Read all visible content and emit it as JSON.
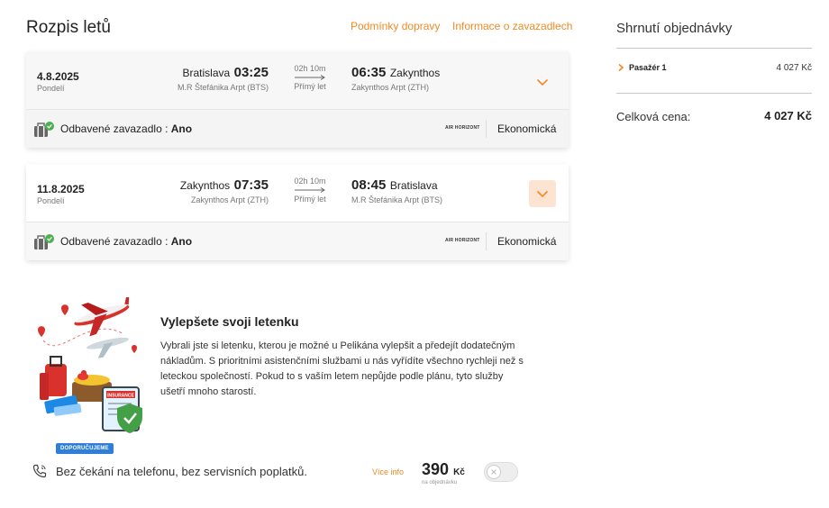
{
  "header": {
    "title": "Rozpis letů",
    "links": [
      "Podmínky dopravy",
      "Informace o zavazadlech"
    ]
  },
  "flights": [
    {
      "date": "4.8.2025",
      "weekday": "Pondelí",
      "dep_city": "Bratislava",
      "dep_time": "03:25",
      "dep_airport": "M.R Štefánika Arpt (BTS)",
      "duration": "02h 10m",
      "stops": "Přímý let",
      "arr_time": "06:35",
      "arr_city": "Zakynthos",
      "arr_airport": "Zakynthos Arpt (ZTH)",
      "baggage_label": "Odbavené zavazadlo :",
      "baggage_value": "Ano",
      "airline": "AIR HORIZONT",
      "fare_class": "Ekonomická"
    },
    {
      "date": "11.8.2025",
      "weekday": "Pondelí",
      "dep_city": "Zakynthos",
      "dep_time": "07:35",
      "dep_airport": "Zakynthos Arpt (ZTH)",
      "duration": "02h 10m",
      "stops": "Přímý let",
      "arr_time": "08:45",
      "arr_city": "Bratislava",
      "arr_airport": "M.R Štefánika Arpt (BTS)",
      "baggage_label": "Odbavené zavazadlo :",
      "baggage_value": "Ano",
      "airline": "AIR HORIZONT",
      "fare_class": "Ekonomická"
    }
  ],
  "summary": {
    "title": "Shrnutí objednávky",
    "passenger_label": "Pasažér 1",
    "passenger_price": "4 027 Kč",
    "total_label": "Celková cena:",
    "total_price": "4 027 Kč"
  },
  "upsell": {
    "badge": "DOPORUČUJEME",
    "title": "Vylepšete svoji letenku",
    "text": "Vybrali jste si letenku, kterou je možné u Pelikána vylepšit a předejít dodatečným nákladům. S prioritními asistenčními službami u nás vyřídíte všechno rychleji než s leteckou společností. Pokud to s vaším letem nepůjde podle plánu, tyto služby ušetří mnoho starostí.",
    "illustration_label": "INSURANCE",
    "service_label": "Bez čekání na telefonu, bez servisních poplatků.",
    "more_info": "Více info",
    "price": "390",
    "currency": "Kč",
    "price_note": "na objednávku",
    "toggle_on": false
  },
  "colors": {
    "accent": "#f08a24",
    "badge": "#2f7fd9",
    "chevron_bg": "#fde3d1",
    "check_green": "#4caf50"
  },
  "icons": [
    "chevron-down-icon",
    "luggage-icon",
    "check-icon",
    "phone-icon",
    "close-icon",
    "chevron-right-icon",
    "arrow-right-icon"
  ]
}
